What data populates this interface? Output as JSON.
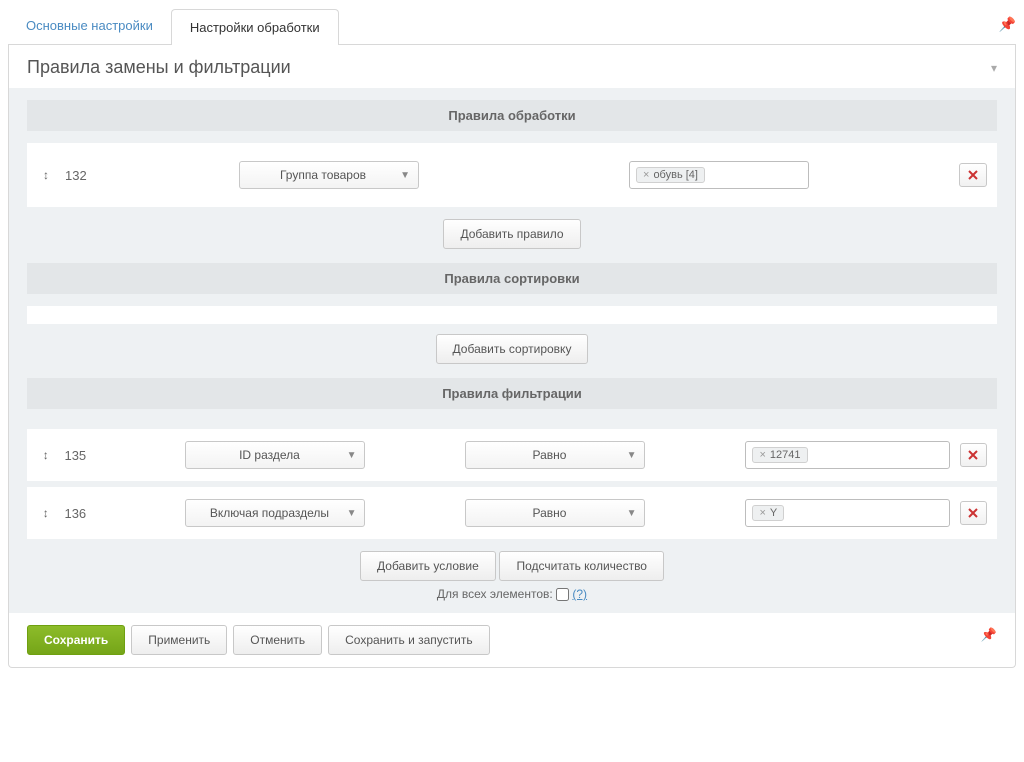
{
  "tabs": {
    "main": "Основные настройки",
    "processing": "Настройки обработки"
  },
  "panel_title": "Правила замены и фильтрации",
  "sections": {
    "processing_rules": "Правила обработки",
    "sorting_rules": "Правила сортировки",
    "filter_rules": "Правила фильтрации"
  },
  "rules": {
    "processing": {
      "id": "132",
      "select_label": "Группа товаров",
      "tag_value": "обувь [4]"
    }
  },
  "buttons": {
    "add_rule": "Добавить правило",
    "add_sort": "Добавить сортировку",
    "add_condition": "Добавить условие",
    "count": "Подсчитать количество"
  },
  "filters": [
    {
      "id": "135",
      "field": "ID раздела",
      "op": "Равно",
      "value": "12741"
    },
    {
      "id": "136",
      "field": "Включая подразделы",
      "op": "Равно",
      "value": "Y"
    }
  ],
  "checkbox_label": "Для всех элементов:",
  "help_link": "(?)",
  "footer": {
    "save": "Сохранить",
    "apply": "Применить",
    "cancel": "Отменить",
    "save_run": "Сохранить и запустить"
  }
}
